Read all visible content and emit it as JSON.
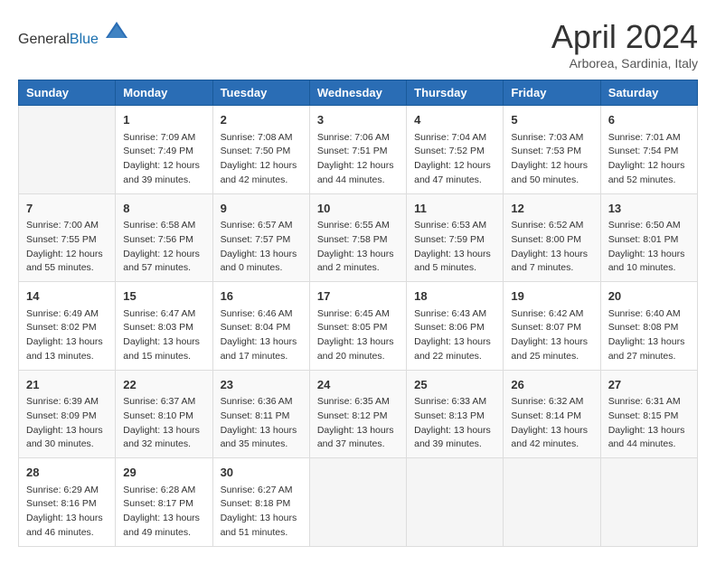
{
  "header": {
    "logo_general": "General",
    "logo_blue": "Blue",
    "month_title": "April 2024",
    "location": "Arborea, Sardinia, Italy"
  },
  "days_of_week": [
    "Sunday",
    "Monday",
    "Tuesday",
    "Wednesday",
    "Thursday",
    "Friday",
    "Saturday"
  ],
  "weeks": [
    [
      {
        "day": "",
        "info": ""
      },
      {
        "day": "1",
        "info": "Sunrise: 7:09 AM\nSunset: 7:49 PM\nDaylight: 12 hours\nand 39 minutes."
      },
      {
        "day": "2",
        "info": "Sunrise: 7:08 AM\nSunset: 7:50 PM\nDaylight: 12 hours\nand 42 minutes."
      },
      {
        "day": "3",
        "info": "Sunrise: 7:06 AM\nSunset: 7:51 PM\nDaylight: 12 hours\nand 44 minutes."
      },
      {
        "day": "4",
        "info": "Sunrise: 7:04 AM\nSunset: 7:52 PM\nDaylight: 12 hours\nand 47 minutes."
      },
      {
        "day": "5",
        "info": "Sunrise: 7:03 AM\nSunset: 7:53 PM\nDaylight: 12 hours\nand 50 minutes."
      },
      {
        "day": "6",
        "info": "Sunrise: 7:01 AM\nSunset: 7:54 PM\nDaylight: 12 hours\nand 52 minutes."
      }
    ],
    [
      {
        "day": "7",
        "info": "Sunrise: 7:00 AM\nSunset: 7:55 PM\nDaylight: 12 hours\nand 55 minutes."
      },
      {
        "day": "8",
        "info": "Sunrise: 6:58 AM\nSunset: 7:56 PM\nDaylight: 12 hours\nand 57 minutes."
      },
      {
        "day": "9",
        "info": "Sunrise: 6:57 AM\nSunset: 7:57 PM\nDaylight: 13 hours\nand 0 minutes."
      },
      {
        "day": "10",
        "info": "Sunrise: 6:55 AM\nSunset: 7:58 PM\nDaylight: 13 hours\nand 2 minutes."
      },
      {
        "day": "11",
        "info": "Sunrise: 6:53 AM\nSunset: 7:59 PM\nDaylight: 13 hours\nand 5 minutes."
      },
      {
        "day": "12",
        "info": "Sunrise: 6:52 AM\nSunset: 8:00 PM\nDaylight: 13 hours\nand 7 minutes."
      },
      {
        "day": "13",
        "info": "Sunrise: 6:50 AM\nSunset: 8:01 PM\nDaylight: 13 hours\nand 10 minutes."
      }
    ],
    [
      {
        "day": "14",
        "info": "Sunrise: 6:49 AM\nSunset: 8:02 PM\nDaylight: 13 hours\nand 13 minutes."
      },
      {
        "day": "15",
        "info": "Sunrise: 6:47 AM\nSunset: 8:03 PM\nDaylight: 13 hours\nand 15 minutes."
      },
      {
        "day": "16",
        "info": "Sunrise: 6:46 AM\nSunset: 8:04 PM\nDaylight: 13 hours\nand 17 minutes."
      },
      {
        "day": "17",
        "info": "Sunrise: 6:45 AM\nSunset: 8:05 PM\nDaylight: 13 hours\nand 20 minutes."
      },
      {
        "day": "18",
        "info": "Sunrise: 6:43 AM\nSunset: 8:06 PM\nDaylight: 13 hours\nand 22 minutes."
      },
      {
        "day": "19",
        "info": "Sunrise: 6:42 AM\nSunset: 8:07 PM\nDaylight: 13 hours\nand 25 minutes."
      },
      {
        "day": "20",
        "info": "Sunrise: 6:40 AM\nSunset: 8:08 PM\nDaylight: 13 hours\nand 27 minutes."
      }
    ],
    [
      {
        "day": "21",
        "info": "Sunrise: 6:39 AM\nSunset: 8:09 PM\nDaylight: 13 hours\nand 30 minutes."
      },
      {
        "day": "22",
        "info": "Sunrise: 6:37 AM\nSunset: 8:10 PM\nDaylight: 13 hours\nand 32 minutes."
      },
      {
        "day": "23",
        "info": "Sunrise: 6:36 AM\nSunset: 8:11 PM\nDaylight: 13 hours\nand 35 minutes."
      },
      {
        "day": "24",
        "info": "Sunrise: 6:35 AM\nSunset: 8:12 PM\nDaylight: 13 hours\nand 37 minutes."
      },
      {
        "day": "25",
        "info": "Sunrise: 6:33 AM\nSunset: 8:13 PM\nDaylight: 13 hours\nand 39 minutes."
      },
      {
        "day": "26",
        "info": "Sunrise: 6:32 AM\nSunset: 8:14 PM\nDaylight: 13 hours\nand 42 minutes."
      },
      {
        "day": "27",
        "info": "Sunrise: 6:31 AM\nSunset: 8:15 PM\nDaylight: 13 hours\nand 44 minutes."
      }
    ],
    [
      {
        "day": "28",
        "info": "Sunrise: 6:29 AM\nSunset: 8:16 PM\nDaylight: 13 hours\nand 46 minutes."
      },
      {
        "day": "29",
        "info": "Sunrise: 6:28 AM\nSunset: 8:17 PM\nDaylight: 13 hours\nand 49 minutes."
      },
      {
        "day": "30",
        "info": "Sunrise: 6:27 AM\nSunset: 8:18 PM\nDaylight: 13 hours\nand 51 minutes."
      },
      {
        "day": "",
        "info": ""
      },
      {
        "day": "",
        "info": ""
      },
      {
        "day": "",
        "info": ""
      },
      {
        "day": "",
        "info": ""
      }
    ]
  ]
}
